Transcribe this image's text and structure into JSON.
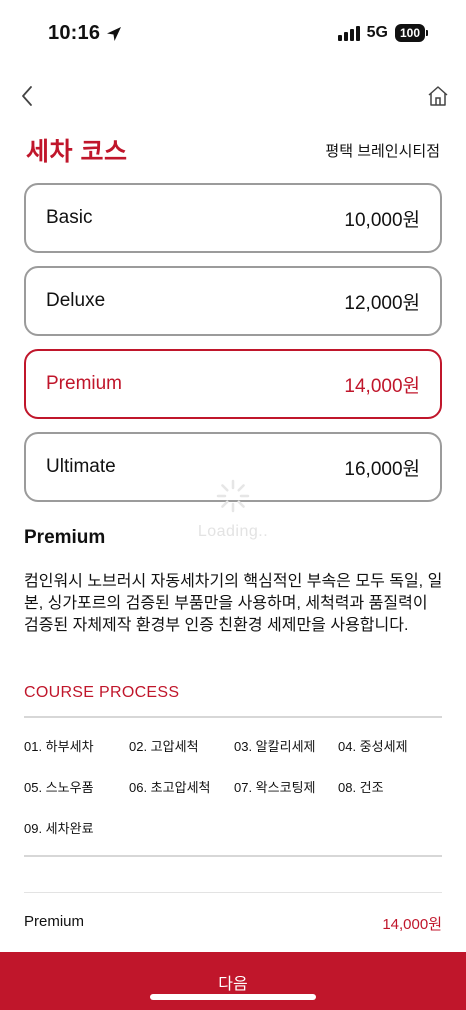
{
  "status_bar": {
    "time": "10:16",
    "network": "5G",
    "battery": "100"
  },
  "nav": {
    "back_icon": "chevron-left-icon",
    "home_icon": "home-icon"
  },
  "header": {
    "title": "세차 코스",
    "store": "평택 브레인시티점"
  },
  "courses": [
    {
      "name": "Basic",
      "price": "10,000원",
      "selected": false
    },
    {
      "name": "Deluxe",
      "price": "12,000원",
      "selected": false
    },
    {
      "name": "Premium",
      "price": "14,000원",
      "selected": true
    },
    {
      "name": "Ultimate",
      "price": "16,000원",
      "selected": false
    }
  ],
  "loading": {
    "text": "Loading.."
  },
  "detail": {
    "title": "Premium",
    "description": "컴인워시 노브러시 자동세차기의 핵심적인 부속은 모두 독일, 일본, 싱가포르의 검증된 부품만을 사용하며, 세척력과 품질력이 검증된 자체제작 환경부 인증 친환경 세제만을 사용합니다."
  },
  "process": {
    "title": "COURSE PROCESS",
    "steps": [
      "01. 하부세차",
      "02. 고압세척",
      "03. 알칼리세제",
      "04. 중성세제",
      "05. 스노우폼",
      "06. 초고압세척",
      "07. 왁스코팅제",
      "08. 건조",
      "09. 세차완료"
    ]
  },
  "summary": {
    "name": "Premium",
    "price": "14,000원"
  },
  "footer": {
    "next_label": "다음"
  },
  "colors": {
    "accent": "#c0162b",
    "border": "#9b9b9b",
    "divider": "#d7d7d7"
  }
}
